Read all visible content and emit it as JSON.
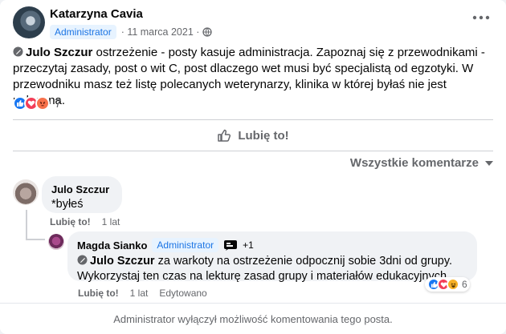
{
  "post": {
    "author": "Katarzyna Cavia",
    "role_badge": "Administrator",
    "date": "· 11 marca 2021 ·",
    "moderated_name": "Julo Szczur",
    "text": " ostrzeżenie - posty kasuje administracja. Zapoznaj się z przewodnikami - przeczytaj zasady, post o wit C, post dlaczego wet musi być specjalistą od egzotyki. W przewodniku masz też listę polecanych weterynarzy, klinika w której byłaś nie jest polecana.",
    "reaction_count": "7",
    "reaction_icons": [
      "like-icon",
      "love-icon",
      "angry-icon"
    ],
    "like_label": "Lubię to!"
  },
  "comments_filter": "Wszystkie komentarze",
  "comments": [
    {
      "author": "Julo Szczur",
      "text": "*byłeś",
      "like_action": "Lubię to!",
      "time": "1 lat"
    }
  ],
  "reply": {
    "author": "Magda Sianko",
    "role_badge": "Administrator",
    "extra_badges": "+1",
    "moderated_name": "Julo Szczur",
    "text": " za warkoty na ostrzeżenie odpocznij sobie 3dni od grupy. Wykorzystaj ten czas na lekturę zasad grupy i materiałów edukacyjnych.",
    "like_action": "Lubię to!",
    "time": "1 lat",
    "edited": "Edytowano",
    "reaction_count": "6",
    "reaction_icons": [
      "like-icon",
      "love-icon",
      "haha-icon"
    ]
  },
  "footer_notice": "Administrator wyłączył możliwość komentowania tego posta.",
  "colors": {
    "accent": "#1b74e4",
    "like": "#1877f2",
    "love": "#f33e58",
    "angry": "#f7714b",
    "haha": "#f7b125"
  }
}
